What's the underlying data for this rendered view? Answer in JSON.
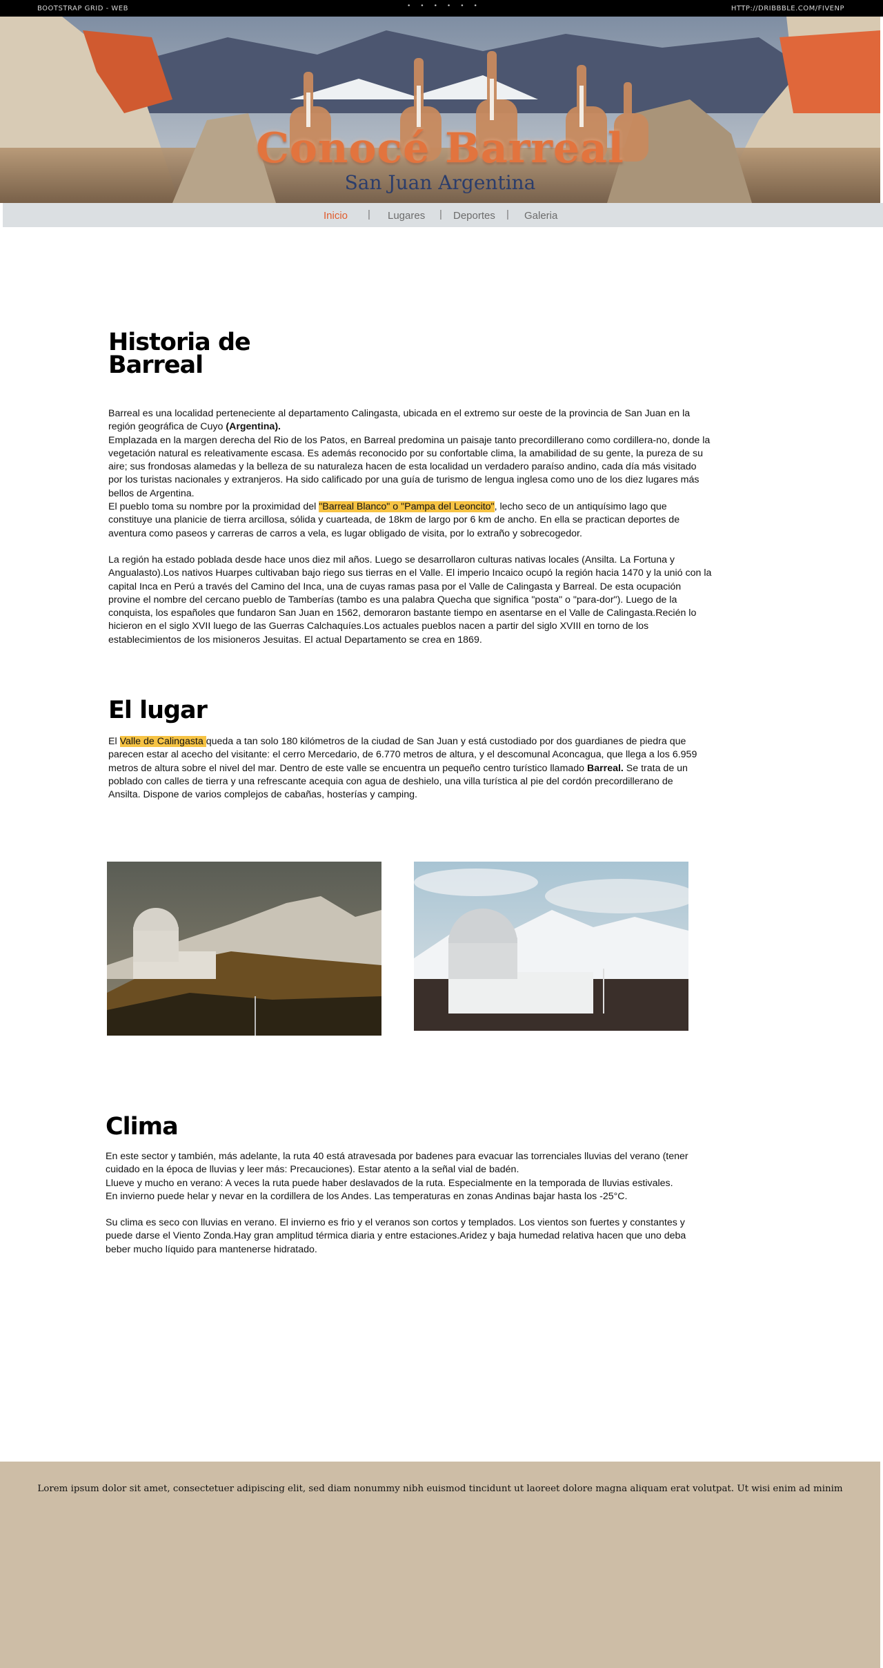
{
  "topbar": {
    "left": "BOOTSTRAP GRID - WEB",
    "right": "HTTP://DRIBBBLE.COM/FIVENP"
  },
  "hero": {
    "title": "Conocé Barreal",
    "subtitle": "San Juan Argentina"
  },
  "nav": {
    "items": [
      {
        "label": "Inicio",
        "active": true
      },
      {
        "label": "Lugares",
        "active": false
      },
      {
        "label": "Deportes",
        "active": false
      },
      {
        "label": "Galeria",
        "active": false
      }
    ],
    "separator": "|"
  },
  "historia": {
    "title_line1": "Historia de",
    "title_line2": "Barreal",
    "p1_a": " Barreal es una localidad perteneciente al departamento Calingasta, ubicada en el extremo sur oeste de la provincia de San Juan en la región geográfica de Cuyo ",
    "p1_b": "(Argentina).",
    "p2": " Emplazada en la margen derecha del Rio de los Patos, en Barreal predomina un paisaje tanto precordillerano como cordillera-no, donde la vegetación natural es releativamente escasa. Es además reconocido por su confortable clima, la amabilidad de su gente, la pureza de su aire; sus frondosas alamedas y la belleza de su naturaleza hacen de esta localidad un verdadero paraíso andino, cada día más visitado por los turistas nacionales y extranjeros. Ha sido calificado por una guía de turismo de lengua inglesa como uno de los diez lugares más bellos de Argentina.",
    "p3_a": "El pueblo toma su nombre por la proximidad del ",
    "p3_hl": "\"Barreal Blanco\" o \"Pampa del Leoncito\"",
    "p3_b": ", lecho seco de un antiquísimo lago que constituye una planicie de tierra arcillosa, sólida y cuarteada, de 18km de largo por 6 km de ancho. En ella se practican deportes de aventura como paseos y carreras de carros a vela, es lugar obligado de visita, por lo extraño y sobrecogedor.",
    "p4": "La región ha estado poblada desde hace unos diez mil años. Luego se desarrollaron culturas nativas locales (Ansilta. La Fortuna y Angualasto).Los nativos Huarpes cultivaban bajo riego sus tierras en el Valle. El imperio Incaico ocupó la región hacia 1470 y la unió con la capital Inca en Perú a través del Camino del Inca, una de cuyas ramas pasa por el Valle de Calingasta y Barreal. De esta ocupación provine el nombre del cercano pueblo de Tamberías (tambo es una palabra Quecha que significa \"posta\" o \"para-dor\"). Luego de la conquista, los españoles que fundaron San Juan en 1562, demoraron bastante tiempo en asentarse en el Valle de Calingasta.Recién lo hicieron en el siglo XVII luego de las Guerras Calchaquíes.Los actuales pueblos nacen a partir del siglo XVIII en torno de los establecimientos de los misioneros Jesuitas. El actual Departamento se crea en 1869."
  },
  "lugar": {
    "title": "El lugar",
    "p_a": " El ",
    "p_hl": "Valle de Calingasta ",
    "p_b": "queda a tan solo 180 kilómetros de la ciudad de San Juan y está custodiado por dos guardianes de piedra que parecen estar al acecho del visitante: el cerro Mercedario, de 6.770 metros de altura, y el descomunal Aconcagua, que llega a los 6.959 metros de altura sobre el nivel del mar. Dentro de este valle se encuentra un pequeño centro turístico llamado ",
    "p_bold": "Barreal.",
    "p_c": " Se trata de un poblado con calles de tierra y una refrescante acequia con agua de deshielo, una villa turística al pie del cordón precordillerano de Ansilta. Dispone de varios complejos de cabañas, hosterías y camping."
  },
  "clima": {
    "title": "Clima",
    "l1": "En este sector y también, más adelante, la ruta 40 está atravesada por badenes para evacuar las torrenciales lluvias del verano (tener cuidado en la época de lluvias y leer más: Precauciones). Estar atento a la señal vial de badén.",
    "l2": "Llueve y mucho en verano: A veces la ruta puede haber deslavados de la ruta. Especialmente en la temporada de lluvias estivales.",
    "l3": "En invierno puede helar y nevar en la cordillera de los Andes. Las temperaturas en zonas Andinas bajar hasta los -25°C.",
    "l4": "Su clima es seco con lluvias en verano. El invierno es frio y el veranos son cortos y templados. Los vientos son fuertes y constantes y puede darse el Viento Zonda.Hay gran amplitud térmica diaria y entre estaciones.Aridez y baja humedad relativa hacen que uno deba beber mucho líquido para mantenerse hidratado."
  },
  "footer": {
    "text": "Lorem ipsum dolor sit amet, consectetuer adipiscing elit, sed diam nonummy nibh euismod tincidunt ut laoreet dolore magna aliquam erat volutpat. Ut wisi enim ad minim"
  },
  "colors": {
    "accent": "#e05b2c",
    "highlight": "#f6c344",
    "nav_bg": "#dbdfe2",
    "footer_bg": "#cdbda6"
  }
}
